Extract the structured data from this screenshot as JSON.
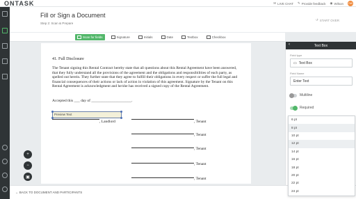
{
  "app": {
    "logo": "ONTASK"
  },
  "topbar": {
    "live_chat": "LIVE CHAT",
    "provide_feedback": "Provide feedback",
    "user_name": "Wilson",
    "avatar_initials": "DW"
  },
  "header": {
    "title": "Fill or Sign a Document",
    "step": "Step 2: Scan & Prepare",
    "start_over": "START OVER"
  },
  "toolbar": {
    "tools": [
      {
        "label": "Scan for fields",
        "icon": "scan-icon"
      },
      {
        "label": "Signature",
        "icon": "signature-icon"
      },
      {
        "label": "Initials",
        "icon": "initials-icon"
      },
      {
        "label": "Date",
        "icon": "calendar-icon"
      },
      {
        "label": "Textbox",
        "icon": "textbox-icon"
      },
      {
        "label": "Checkbox",
        "icon": "checkbox-icon"
      }
    ]
  },
  "document": {
    "heading": "41. Full Disclosure",
    "paragraph": "The Tenant signing this Rental Contract hereby state that all questions about this Rental Agreement have been answered, that they fully understand all the provisions of the agreement and the obligations and responsibilities of each party, as spelled out herein. They further state that they agree to fulfill their obligations in every respect or suffer the full legal and financial consequences of their actions or lack of action in violation of this agreement. Signature by the Tenant on this Rental Agreement is acknowledgment and he/she has received a signed copy of the Rental Agreement.",
    "accepted": "Accepted this ___ day of _____________________.",
    "preview_text": "Preview Text",
    "landlord_label": ", Landlord",
    "tenant_label": ", Tenant"
  },
  "footer": {
    "back": "BACK TO DOCUMENT AND PARTICIPANTS"
  },
  "panel": {
    "title": "Text Box",
    "field_type_label": "Field type",
    "field_type_value": "Text Box",
    "field_name_label": "Field Name",
    "field_name_value": "Enter Text",
    "multiline_label": "Multiline",
    "multiline_on": false,
    "required_label": "Required",
    "required_on": true
  },
  "font_sizes": {
    "options": [
      "6 pt",
      "8 pt",
      "10 pt",
      "12 pt",
      "14 pt",
      "16 pt",
      "18 pt",
      "20 pt",
      "22 pt",
      "24 pt"
    ],
    "selected": "8 pt"
  },
  "colors": {
    "accent": "#52b76a",
    "rail": "#2f3436",
    "avatar": "#f08a3c"
  }
}
